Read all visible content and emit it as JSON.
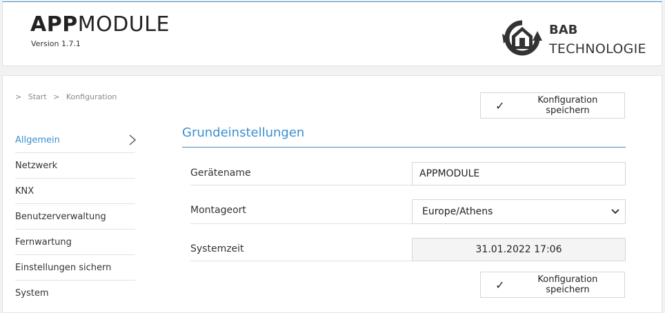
{
  "header": {
    "title_bold": "APP",
    "title_light": "MODULE",
    "version": "Version 1.7.1",
    "brand_line1": "BAB",
    "brand_line2": "TECHNOLOGIE"
  },
  "breadcrumb": {
    "separator": ">",
    "items": [
      "Start",
      "Konfiguration"
    ]
  },
  "actions": {
    "save_label": "Konfiguration speichern"
  },
  "sidebar": {
    "items": [
      {
        "label": "Allgemein",
        "active": true
      },
      {
        "label": "Netzwerk"
      },
      {
        "label": "KNX"
      },
      {
        "label": "Benutzerverwaltung"
      },
      {
        "label": "Fernwartung"
      },
      {
        "label": "Einstellungen sichern"
      },
      {
        "label": "System"
      }
    ]
  },
  "section": {
    "title": "Grundeinstellungen",
    "rows": [
      {
        "label": "Gerätename",
        "value": "APPMODULE"
      },
      {
        "label": "Montageort",
        "value": "Europe/Athens"
      },
      {
        "label": "Systemzeit",
        "value": "31.01.2022 17:06"
      }
    ]
  },
  "colors": {
    "accent": "#3a8fd0",
    "border": "#e1e1e1",
    "text": "#333333"
  },
  "icons": {
    "check": "check-icon",
    "chevron": "chevron-right-icon",
    "select_arrow": "chevron-down-icon",
    "logo": "bab-house-logo-icon"
  }
}
